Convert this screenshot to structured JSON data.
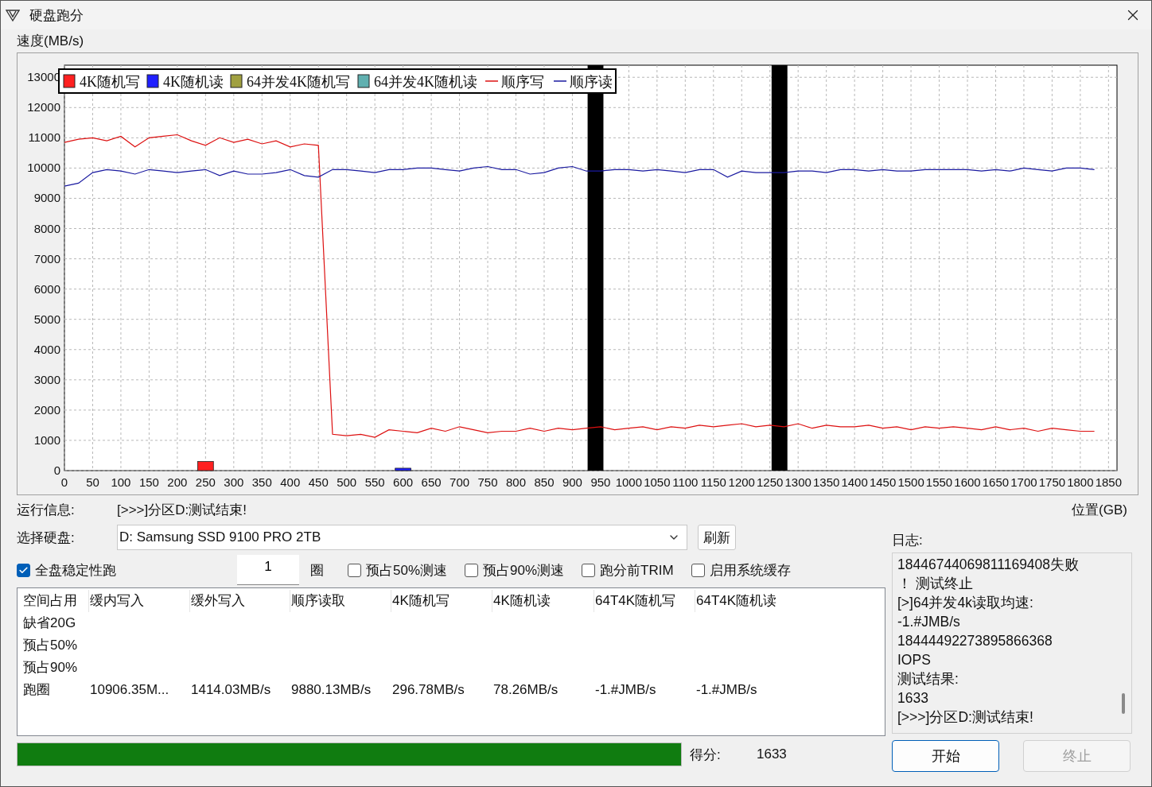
{
  "window": {
    "title": "硬盘跑分"
  },
  "chart": {
    "chart_data": {
      "type": "line",
      "xlabel": "位置(GB)",
      "ylabel": "速度(MB/s)",
      "x": [
        0,
        25,
        50,
        75,
        100,
        125,
        150,
        175,
        200,
        225,
        250,
        275,
        300,
        325,
        350,
        375,
        400,
        425,
        450,
        475,
        500,
        525,
        550,
        575,
        600,
        625,
        650,
        675,
        700,
        725,
        750,
        775,
        800,
        825,
        850,
        875,
        900,
        925,
        950,
        975,
        1000,
        1025,
        1050,
        1075,
        1100,
        1125,
        1150,
        1175,
        1200,
        1225,
        1250,
        1275,
        1300,
        1325,
        1350,
        1375,
        1400,
        1425,
        1450,
        1475,
        1500,
        1525,
        1550,
        1575,
        1600,
        1625,
        1650,
        1675,
        1700,
        1725,
        1750,
        1775,
        1800,
        1825
      ],
      "series": [
        {
          "name": "4K随机写",
          "type": "bar",
          "color": "#ff2020",
          "values": [
            null,
            null,
            null,
            null,
            null,
            null,
            null,
            null,
            null,
            null,
            300,
            null,
            null,
            null,
            null,
            null,
            null,
            null,
            null,
            null,
            null,
            null,
            null,
            null,
            null,
            null,
            null,
            null,
            null,
            null,
            null,
            null,
            null,
            null,
            null,
            null,
            null,
            null,
            null,
            null,
            null,
            null,
            null,
            null,
            null,
            null,
            null,
            null,
            null,
            null,
            null,
            null,
            null,
            null,
            null,
            null,
            null,
            null,
            null,
            null,
            null,
            null,
            null,
            null,
            null,
            null,
            null,
            null,
            null,
            null,
            null,
            null,
            null,
            null
          ]
        },
        {
          "name": "4K随机读",
          "type": "bar",
          "color": "#2020ff",
          "values": [
            null,
            null,
            null,
            null,
            null,
            null,
            null,
            null,
            null,
            null,
            null,
            null,
            null,
            null,
            null,
            null,
            null,
            null,
            null,
            null,
            null,
            null,
            null,
            null,
            80,
            null,
            null,
            null,
            null,
            null,
            null,
            null,
            null,
            null,
            null,
            null,
            null,
            null,
            null,
            null,
            null,
            null,
            null,
            null,
            null,
            null,
            null,
            null,
            null,
            null,
            null,
            null,
            null,
            null,
            null,
            null,
            null,
            null,
            null,
            null,
            null,
            null,
            null,
            null,
            null,
            null,
            null,
            null,
            null,
            null,
            null,
            null,
            null,
            null
          ]
        },
        {
          "name": "64并发4K随机写",
          "type": "bar",
          "color": "#a0a040",
          "values": [
            null,
            null,
            null,
            null,
            null,
            null,
            null,
            null,
            null,
            null,
            null,
            null,
            null,
            null,
            null,
            null,
            null,
            null,
            null,
            null,
            null,
            null,
            null,
            null,
            null,
            null,
            null,
            null,
            null,
            null,
            null,
            null,
            null,
            null,
            null,
            null,
            null,
            null,
            null,
            null,
            null,
            null,
            null,
            null,
            null,
            null,
            null,
            null,
            null,
            null,
            null,
            null,
            null,
            null,
            null,
            null,
            null,
            null,
            null,
            null,
            null,
            null,
            null,
            null,
            null,
            null,
            null,
            null,
            null,
            null,
            null,
            null,
            null,
            null
          ]
        },
        {
          "name": "64并发4K随机读",
          "type": "bar",
          "color": "#60b0b0",
          "values": [
            null,
            null,
            null,
            null,
            null,
            null,
            null,
            null,
            null,
            null,
            null,
            null,
            null,
            null,
            null,
            null,
            null,
            null,
            null,
            null,
            null,
            null,
            null,
            null,
            null,
            null,
            null,
            null,
            null,
            null,
            null,
            null,
            null,
            null,
            null,
            null,
            null,
            null,
            null,
            null,
            null,
            null,
            null,
            null,
            null,
            null,
            null,
            null,
            null,
            null,
            null,
            null,
            null,
            null,
            null,
            null,
            null,
            null,
            null,
            null,
            null,
            null,
            null,
            null,
            null,
            null,
            null,
            null,
            null,
            null,
            null,
            null,
            null,
            null
          ]
        },
        {
          "name": "顺序写",
          "type": "line",
          "color": "#dd1010",
          "values": [
            10850,
            10950,
            11000,
            10900,
            11050,
            10700,
            11000,
            11050,
            11100,
            10900,
            10750,
            11000,
            10850,
            10950,
            10800,
            10900,
            10700,
            10800,
            10750,
            1200,
            1150,
            1200,
            1100,
            1350,
            1300,
            1250,
            1400,
            1300,
            1450,
            1350,
            1250,
            1300,
            1300,
            1400,
            1300,
            1400,
            1350,
            1400,
            1450,
            1350,
            1400,
            1450,
            1350,
            1450,
            1400,
            1500,
            1450,
            1500,
            1550,
            1450,
            1500,
            1450,
            1550,
            1400,
            1500,
            1450,
            1450,
            1500,
            1400,
            1450,
            1350,
            1450,
            1400,
            1450,
            1400,
            1350,
            1450,
            1350,
            1400,
            1300,
            1400,
            1350,
            1300,
            1300
          ]
        },
        {
          "name": "顺序读",
          "type": "line",
          "color": "#1a1aa0",
          "values": [
            9400,
            9500,
            9850,
            9950,
            9900,
            9800,
            9950,
            9900,
            9850,
            9900,
            9950,
            9750,
            9900,
            9800,
            9800,
            9850,
            9950,
            9750,
            9700,
            9950,
            9950,
            9900,
            9850,
            9950,
            9950,
            10000,
            10000,
            9950,
            9900,
            10000,
            10050,
            9950,
            9950,
            9800,
            9850,
            10000,
            10050,
            9900,
            9900,
            9950,
            9950,
            9900,
            9950,
            9900,
            9850,
            9950,
            9950,
            9700,
            9900,
            9850,
            9850,
            9850,
            9900,
            9900,
            9850,
            9950,
            9950,
            9900,
            9950,
            9900,
            9900,
            9950,
            9950,
            9950,
            9950,
            9900,
            9950,
            9900,
            10000,
            9950,
            9900,
            10000,
            10000,
            9950
          ]
        }
      ],
      "xlim": [
        0,
        1865
      ],
      "ylim": [
        0,
        13400
      ],
      "xticks": [
        0,
        50,
        100,
        150,
        200,
        250,
        300,
        350,
        400,
        450,
        500,
        550,
        600,
        650,
        700,
        750,
        800,
        850,
        900,
        950,
        1000,
        1050,
        1100,
        1150,
        1200,
        1250,
        1300,
        1350,
        1400,
        1450,
        1500,
        1550,
        1600,
        1650,
        1700,
        1750,
        1800,
        1850
      ],
      "yticks": [
        0,
        1000,
        2000,
        3000,
        4000,
        5000,
        6000,
        7000,
        8000,
        9000,
        10000,
        11000,
        12000,
        13000
      ],
      "grid": true,
      "legend": "upper left",
      "bands": [
        {
          "axis": "x",
          "from": 927,
          "to": 955,
          "color": "#000000"
        },
        {
          "axis": "x",
          "from": 1253,
          "to": 1281,
          "color": "#000000"
        }
      ]
    }
  },
  "run_info": {
    "label": "运行信息:",
    "value": "[>>>]分区D:测试结束!"
  },
  "disk": {
    "label": "选择硬盘:",
    "value": "D: Samsung SSD 9100 PRO 2TB",
    "refresh": "刷新"
  },
  "options": [
    {
      "kind": "checkbox",
      "label": "全盘稳定性跑",
      "checked": true
    },
    {
      "kind": "number",
      "value": "1",
      "unit": "圈"
    },
    {
      "kind": "checkbox",
      "label": "预占50%测速",
      "checked": false
    },
    {
      "kind": "checkbox",
      "label": "预占90%测速",
      "checked": false
    },
    {
      "kind": "checkbox",
      "label": "跑分前TRIM",
      "checked": false
    },
    {
      "kind": "checkbox",
      "label": "启用系统缓存",
      "checked": false
    }
  ],
  "results": {
    "columns": [
      "空间占用",
      "缓内写入",
      "缓外写入",
      "顺序读取",
      "4K随机写",
      "4K随机读",
      "64T4K随机写",
      "64T4K随机读"
    ],
    "rows": [
      {
        "label": "缺省20G"
      },
      {
        "label": "预占50%"
      },
      {
        "label": "预占90%"
      },
      {
        "label": "跑圈",
        "values": [
          "10906.35M...",
          "1414.03MB/s",
          "9880.13MB/s",
          "296.78MB/s",
          "78.26MB/s",
          "-1.#JMB/s",
          "-1.#JMB/s"
        ]
      }
    ]
  },
  "progress": {
    "level": 1
  },
  "score": {
    "label": "得分:",
    "value": "1633"
  },
  "log": {
    "title": "日志:",
    "lines": [
      "18446744069811169408失败",
      "！ 测试终止",
      "[>]64并发4k读取均速:",
      "-1.#JMB/s",
      "18444492273895866368",
      "IOPS",
      "测试结果:",
      "1633",
      "[>>>]分区D:测试结束!"
    ]
  },
  "buttons": [
    {
      "label": "开始",
      "disabled": false
    },
    {
      "label": "终止",
      "disabled": true
    }
  ]
}
